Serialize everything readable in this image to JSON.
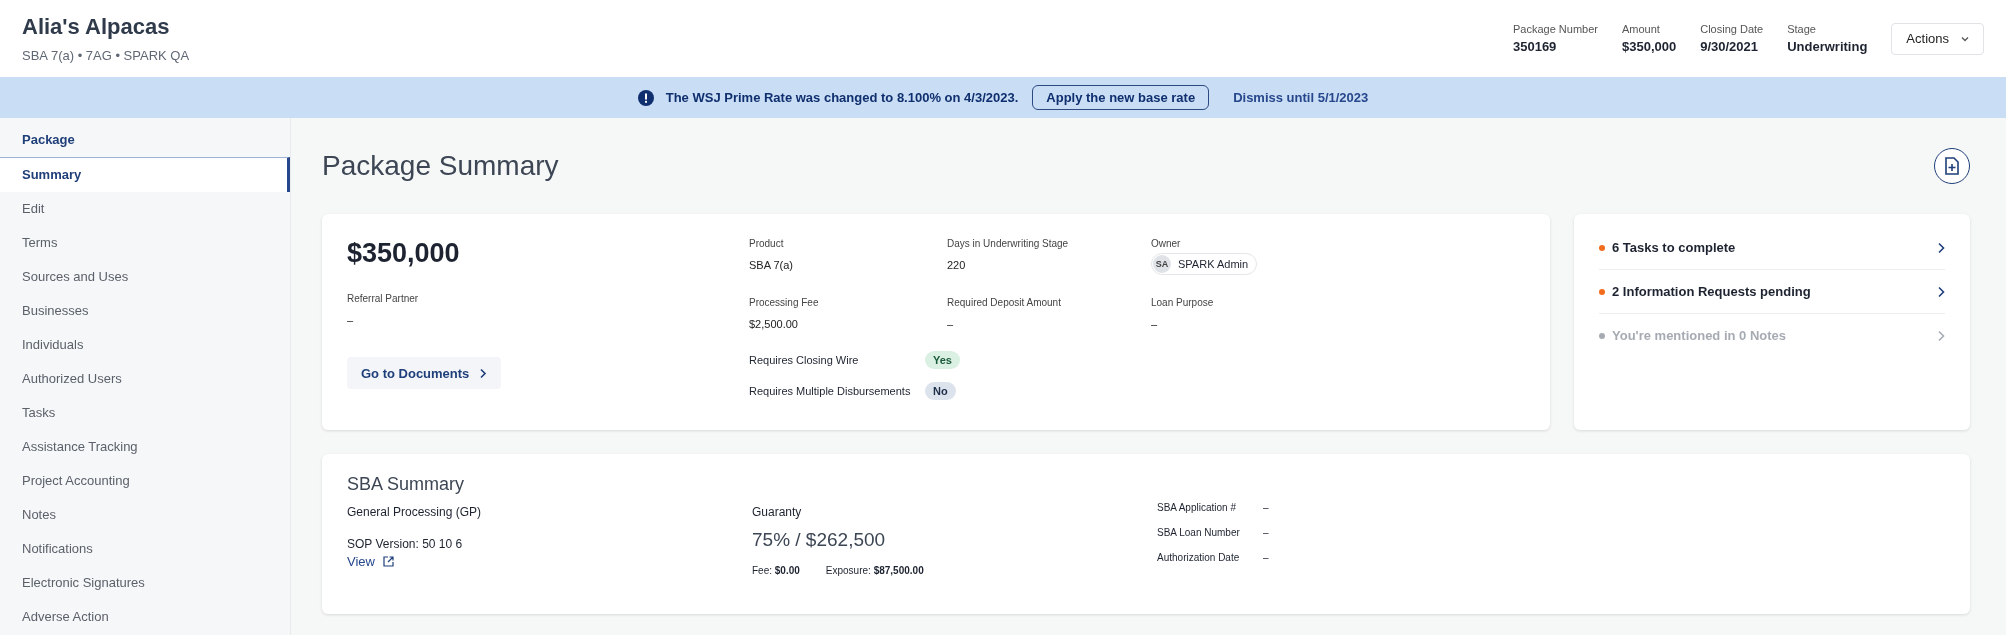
{
  "header": {
    "title": "Alia's Alpacas",
    "subtitle": "SBA 7(a) • 7AG • SPARK QA",
    "stats": [
      {
        "label": "Package Number",
        "value": "350169"
      },
      {
        "label": "Amount",
        "value": "$350,000"
      },
      {
        "label": "Closing Date",
        "value": "9/30/2021"
      },
      {
        "label": "Stage",
        "value": "Underwriting"
      }
    ],
    "actions_button": "Actions"
  },
  "banner": {
    "message": "The WSJ Prime Rate was changed to 8.100% on 4/3/2023.",
    "apply_button": "Apply the new base rate",
    "dismiss_link": "Dismiss until 5/1/2023"
  },
  "sidebar": {
    "heading": "Package",
    "items": [
      {
        "label": "Summary",
        "selected": true
      },
      {
        "label": "Edit",
        "selected": false
      },
      {
        "label": "Terms",
        "selected": false
      },
      {
        "label": "Sources and Uses",
        "selected": false
      },
      {
        "label": "Businesses",
        "selected": false
      },
      {
        "label": "Individuals",
        "selected": false
      },
      {
        "label": "Authorized Users",
        "selected": false
      },
      {
        "label": "Tasks",
        "selected": false
      },
      {
        "label": "Assistance Tracking",
        "selected": false
      },
      {
        "label": "Project Accounting",
        "selected": false
      },
      {
        "label": "Notes",
        "selected": false
      },
      {
        "label": "Notifications",
        "selected": false
      },
      {
        "label": "Electronic Signatures",
        "selected": false
      },
      {
        "label": "Adverse Action",
        "selected": false
      }
    ]
  },
  "page_title": "Package Summary",
  "summary_card": {
    "amount": "$350,000",
    "referral_label": "Referral Partner",
    "referral_value": "–",
    "documents_button": "Go to Documents",
    "fields": [
      {
        "label": "Product",
        "value": "SBA 7(a)"
      },
      {
        "label": "Days in Underwriting Stage",
        "value": "220"
      },
      {
        "label": "Owner",
        "value": "SPARK Admin",
        "initials": "SA"
      },
      {
        "label": "Processing Fee",
        "value": "$2,500.00"
      },
      {
        "label": "Required Deposit Amount",
        "value": "–"
      },
      {
        "label": "Loan Purpose",
        "value": "–"
      }
    ],
    "flags": [
      {
        "label": "Requires Closing Wire",
        "value": "Yes",
        "positive": true
      },
      {
        "label": "Requires Multiple Disbursements",
        "value": "No",
        "positive": false
      }
    ]
  },
  "attention_card": {
    "items": [
      {
        "label": "6 Tasks to complete",
        "active": true,
        "color": "#f26b1d"
      },
      {
        "label": "2 Information Requests pending",
        "active": true,
        "color": "#f26b1d"
      },
      {
        "label": "You're mentioned in 0 Notes",
        "active": false,
        "color": "#a6abb3"
      }
    ]
  },
  "sba_summary": {
    "title": "SBA Summary",
    "processing": "General Processing (GP)",
    "sop_version": "SOP Version: 50 10 6",
    "view_link": "View",
    "guaranty_label": "Guaranty",
    "guaranty_value": "75% / $262,500",
    "fee": "Fee: **$0.00**",
    "exposure": "Exposure: **$87,500.00**",
    "details": [
      {
        "label": "SBA Application #",
        "value": "–"
      },
      {
        "label": "SBA Loan Number",
        "value": "–"
      },
      {
        "label": "Authorization Date",
        "value": "–"
      }
    ]
  }
}
